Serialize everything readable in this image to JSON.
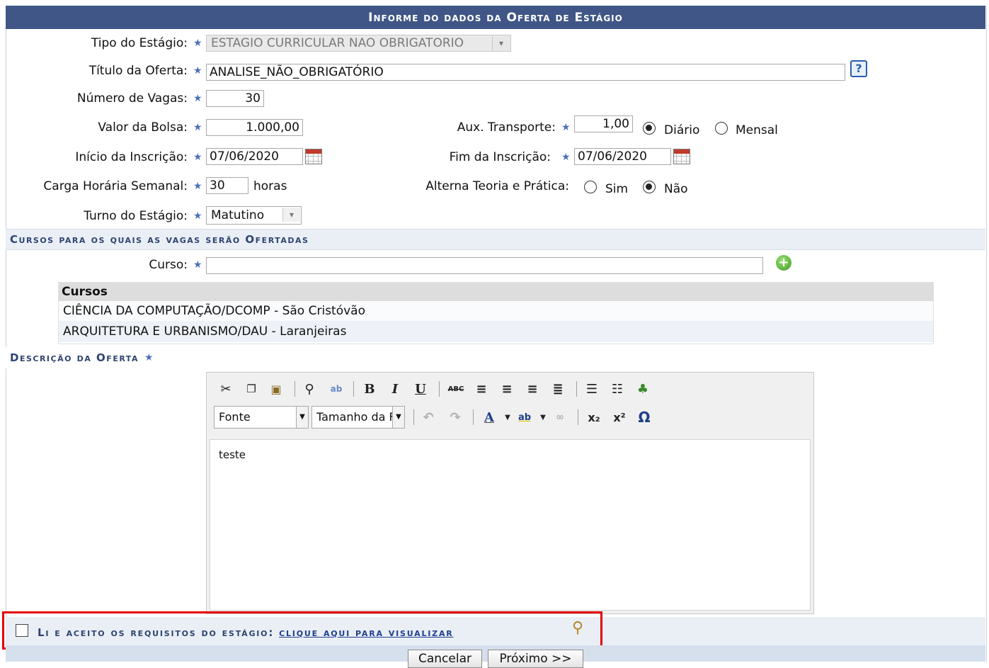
{
  "form": {
    "title": "Informe do dados da Oferta de Estágio",
    "tipo": {
      "label": "Tipo do Estágio:",
      "value": "ESTAGIO CURRICULAR NAO OBRIGATORIO"
    },
    "titulo": {
      "label": "Título da Oferta:",
      "value": "ANALISE_NÃO_OBRIGATÓRIO",
      "help": "?"
    },
    "vagas": {
      "label": "Número de Vagas:",
      "value": "30"
    },
    "bolsa": {
      "label": "Valor da Bolsa:",
      "value": "1.000,00"
    },
    "transporte": {
      "label": "Aux. Transporte:",
      "value": "1,00",
      "opt_diario": "Diário",
      "opt_mensal": "Mensal",
      "selected": "Diário"
    },
    "inicio": {
      "label": "Início da Inscrição:",
      "value": "07/06/2020"
    },
    "fim": {
      "label": "Fim da Inscrição:",
      "value": "07/06/2020"
    },
    "carga": {
      "label": "Carga Horária Semanal:",
      "value": "30",
      "unit": "horas"
    },
    "alterna": {
      "label": "Alterna Teoria e Prática:",
      "opt_sim": "Sim",
      "opt_nao": "Não",
      "selected": "Não"
    },
    "turno": {
      "label": "Turno do Estágio:",
      "value": "Matutino"
    },
    "required_mark": "★"
  },
  "cursos_section": {
    "title": "Cursos para os quais as vagas serão Ofertadas",
    "curso_label": "Curso:",
    "curso_value": "",
    "table_header": "Cursos",
    "rows": [
      "CIÊNCIA DA COMPUTAÇÃO/DCOMP - São Cristóvão",
      "ARQUITETURA E URBANISMO/DAU - Laranjeiras"
    ]
  },
  "descricao_section": {
    "title": "Descrição da Oferta",
    "editor": {
      "font_select": "Fonte",
      "size_select": "Tamanho da Fo",
      "content": "teste",
      "icons": [
        "cut-icon",
        "copy-icon",
        "paste-icon",
        "find-icon",
        "replace-icon",
        "bold-icon",
        "italic-icon",
        "underline-icon",
        "strikethrough-icon",
        "align-left-icon",
        "align-center-icon",
        "align-right-icon",
        "align-justify-icon",
        "bullet-list-icon",
        "numbered-list-icon",
        "image-icon",
        "undo-icon",
        "redo-icon",
        "text-color-icon",
        "highlight-color-icon",
        "link-icon",
        "subscript-icon",
        "superscript-icon",
        "special-char-icon"
      ]
    }
  },
  "accept": {
    "text": "Li e aceito os requisitos do estágio:",
    "link": "clique aqui para visualizar"
  },
  "buttons": {
    "cancel": "Cancelar",
    "next": "Próximo >>"
  },
  "colors": {
    "header": "#3f5686",
    "section": "#eaeff6",
    "accent": "#4b70b8",
    "highlight": "#e30000"
  }
}
